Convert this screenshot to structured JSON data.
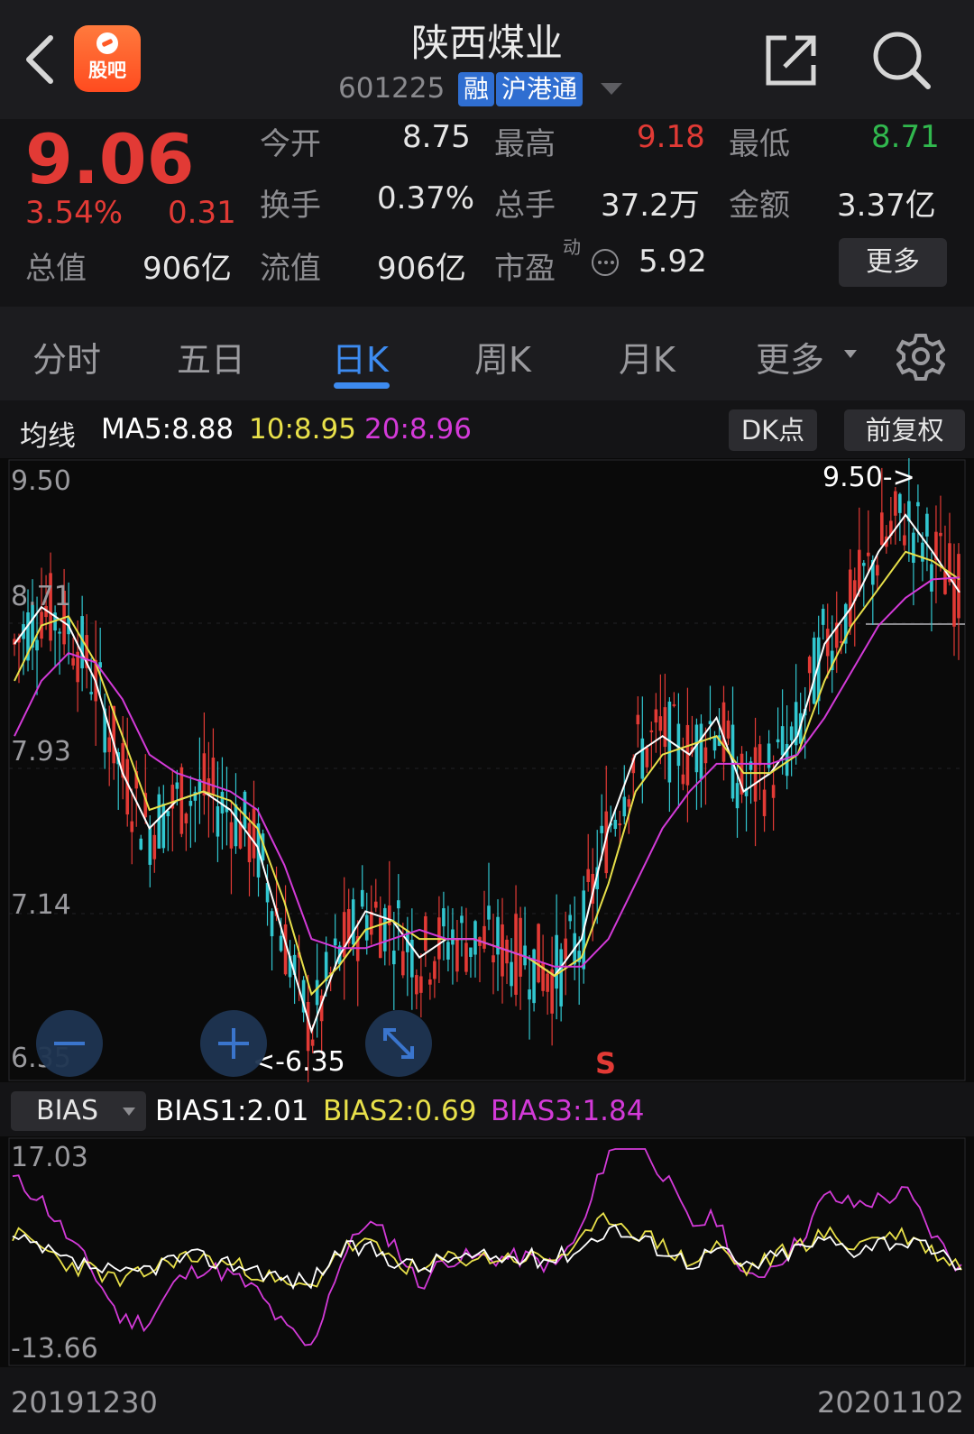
{
  "header": {
    "title": "陕西煤业",
    "code": "601225",
    "tag_margin": "融",
    "tag_connect": "沪港通",
    "logo_text": "股吧"
  },
  "quote": {
    "price": "9.06",
    "change_pct": "3.54%",
    "change_abs": "0.31",
    "open_label": "今开",
    "open_value": "8.75",
    "high_label": "最高",
    "high_value": "9.18",
    "low_label": "最低",
    "low_value": "8.71",
    "turnover_label": "换手",
    "turnover_value": "0.37%",
    "volume_label": "总手",
    "volume_value": "37.2万",
    "amount_label": "金额",
    "amount_value": "3.37亿",
    "mktcap_label": "总值",
    "mktcap_value": "906亿",
    "float_label": "流值",
    "float_value": "906亿",
    "pe_label": "市盈",
    "pe_sup": "动",
    "pe_value": "5.92",
    "more_label": "更多"
  },
  "tabs": [
    "分时",
    "五日",
    "日K",
    "周K",
    "月K",
    "更多"
  ],
  "active_tab": 2,
  "ma": {
    "label": "均线",
    "ma5": "MA5:8.88",
    "ma10": "10:8.95",
    "ma20": "20:8.96",
    "dk_button": "DK点",
    "adjust_button": "前复权"
  },
  "kline": {
    "y_ticks": [
      "9.50",
      "8.71",
      "7.93",
      "7.14",
      "6.35"
    ],
    "high_marker": "9.50->",
    "low_marker": "<-6.35",
    "signal": "S"
  },
  "bias": {
    "selector": "BIAS",
    "bias1": "BIAS1:2.01",
    "bias2": "BIAS2:0.69",
    "bias3": "BIAS3:1.84",
    "y_ticks": [
      "17.03",
      "-13.66"
    ]
  },
  "dates": {
    "start": "20191230",
    "end": "20201102"
  },
  "colors": {
    "up": "#e23a35",
    "down": "#31c6cf",
    "ma5": "#ffffff",
    "ma10": "#e8e04a",
    "ma20": "#d33ad8",
    "accent": "#3d8bf0",
    "green_quote": "#31b84e"
  },
  "chart_data": {
    "type": "line",
    "series": [
      {
        "name": "MA5",
        "values": [
          8.6,
          8.8,
          8.7,
          8.4,
          7.9,
          7.6,
          7.75,
          7.8,
          7.7,
          7.5,
          7.0,
          6.5,
          6.9,
          7.15,
          7.1,
          6.9,
          7.0,
          7.0,
          6.95,
          6.9,
          6.8,
          7.0,
          7.6,
          8.0,
          8.1,
          8.0,
          8.2,
          7.8,
          7.9,
          8.1,
          8.6,
          8.8,
          9.1,
          9.3,
          9.1,
          8.88
        ]
      },
      {
        "name": "10",
        "values": [
          8.4,
          8.7,
          8.75,
          8.5,
          8.1,
          7.7,
          7.75,
          7.8,
          7.75,
          7.6,
          7.2,
          6.7,
          6.85,
          7.05,
          7.1,
          7.0,
          7.0,
          7.0,
          6.95,
          6.9,
          6.8,
          6.9,
          7.3,
          7.8,
          8.0,
          8.05,
          8.1,
          7.9,
          7.9,
          8.0,
          8.4,
          8.7,
          8.9,
          9.1,
          9.05,
          8.95
        ]
      },
      {
        "name": "20",
        "values": [
          8.1,
          8.4,
          8.55,
          8.5,
          8.3,
          8.0,
          7.9,
          7.85,
          7.8,
          7.7,
          7.4,
          7.0,
          6.95,
          6.95,
          7.0,
          7.05,
          7.0,
          7.0,
          6.95,
          6.9,
          6.85,
          6.85,
          7.0,
          7.3,
          7.6,
          7.8,
          7.95,
          7.95,
          7.95,
          8.0,
          8.2,
          8.45,
          8.7,
          8.85,
          8.95,
          8.96
        ]
      }
    ],
    "ylim": [
      6.35,
      9.5
    ]
  }
}
